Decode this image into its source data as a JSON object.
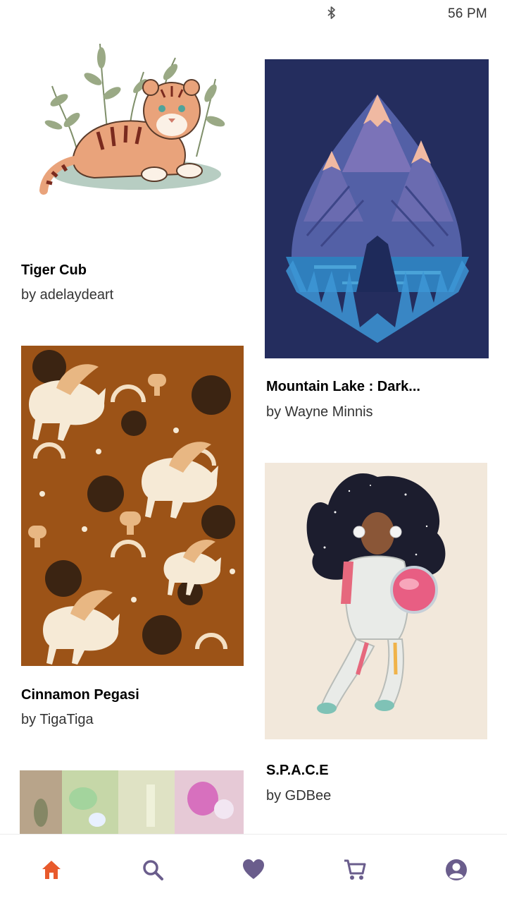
{
  "status_bar": {
    "time": "56 PM",
    "bluetooth_icon": "bluetooth-icon"
  },
  "artworks": [
    {
      "title": "Tiger Cub",
      "artist": "by adelaydeart",
      "image": "tiger-cub-illustration"
    },
    {
      "title": "Mountain Lake : Dark...",
      "artist": "by Wayne Minnis",
      "image": "mountain-lake-illustration"
    },
    {
      "title": "Cinnamon Pegasi",
      "artist": "by TigaTiga",
      "image": "pegasus-pattern-illustration"
    },
    {
      "title": "S.P.A.C.E",
      "artist": "by GDBee",
      "image": "astronaut-girl-illustration"
    },
    {
      "image": "abstract-floral-painting"
    }
  ],
  "bottom_nav": {
    "items": [
      {
        "icon": "home-icon",
        "active": true
      },
      {
        "icon": "search-icon",
        "active": false
      },
      {
        "icon": "heart-icon",
        "active": false
      },
      {
        "icon": "cart-icon",
        "active": false
      },
      {
        "icon": "profile-icon",
        "active": false
      }
    ],
    "active_color": "#e85a2c",
    "inactive_color": "#6a5d8c"
  }
}
